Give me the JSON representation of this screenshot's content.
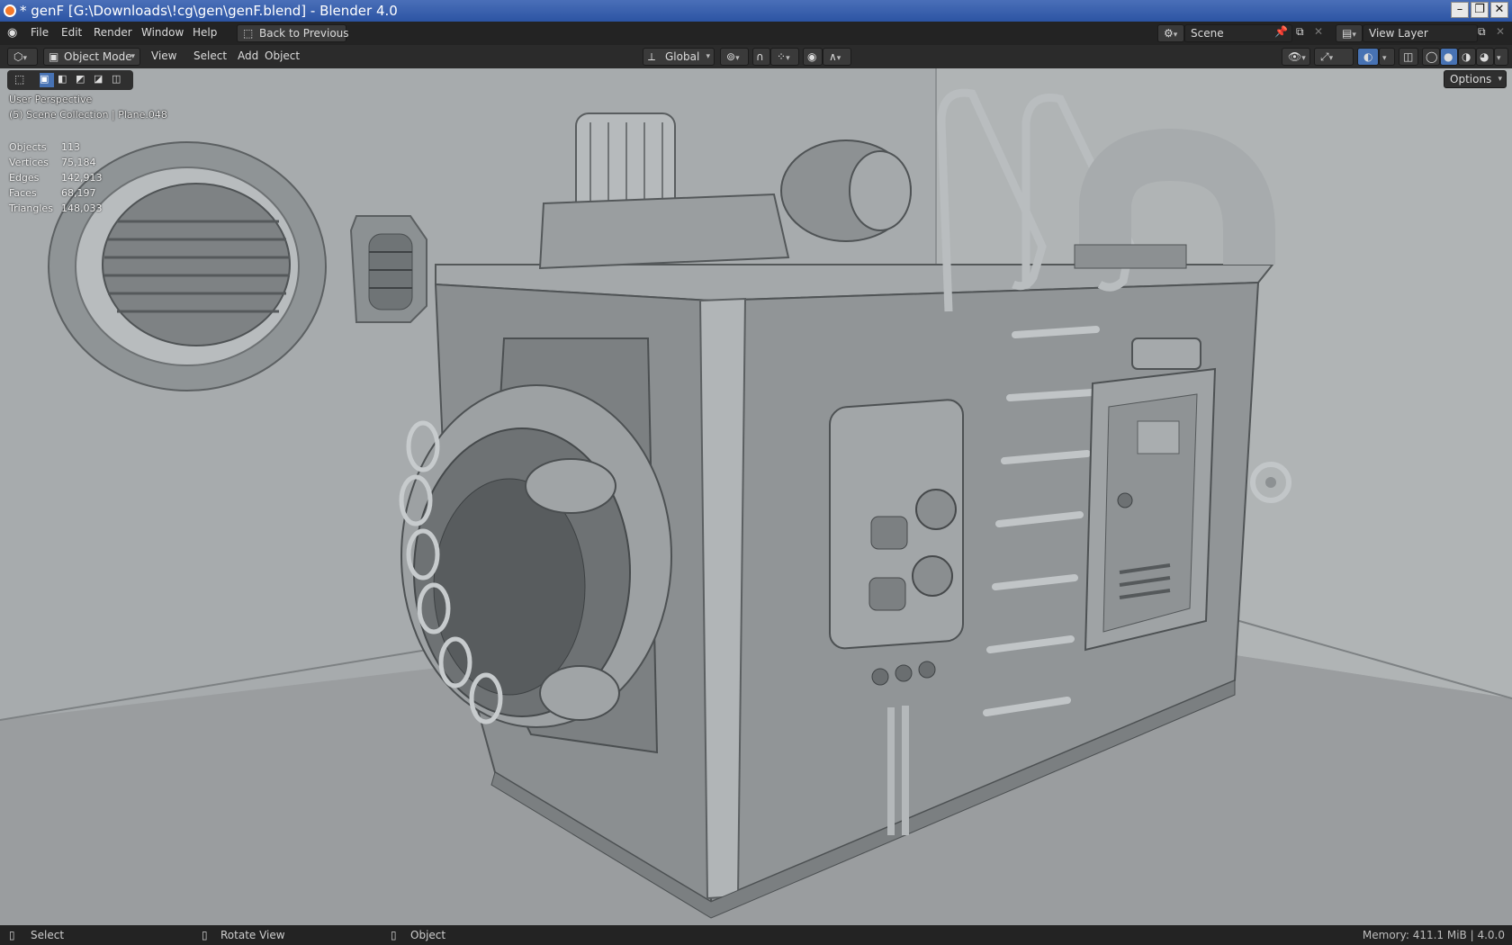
{
  "window": {
    "title": "* genF [G:\\Downloads\\!cg\\gen\\genF.blend] - Blender 4.0"
  },
  "menu": {
    "items": [
      "File",
      "Edit",
      "Render",
      "Window",
      "Help"
    ],
    "back_button": "Back to Previous",
    "scene": "Scene",
    "view_layer": "View Layer"
  },
  "header": {
    "mode": "Object Mode",
    "menus": [
      "View",
      "Select",
      "Add",
      "Object"
    ],
    "transform_orientation": "Global",
    "options": "Options"
  },
  "viewport": {
    "perspective": "User Perspective",
    "collection": "(5) Scene Collection | Plane.048",
    "stats": [
      {
        "label": "Objects",
        "value": "113"
      },
      {
        "label": "Vertices",
        "value": "75,184"
      },
      {
        "label": "Edges",
        "value": "142,913"
      },
      {
        "label": "Faces",
        "value": "68,197"
      },
      {
        "label": "Triangles",
        "value": "148,033"
      }
    ]
  },
  "status": {
    "select": "Select",
    "rotate": "Rotate View",
    "object": "Object",
    "memory": "Memory: 411.1 MiB | 4.0.0"
  },
  "colors": {
    "accent": "#4772b3",
    "brand": "#f5792a",
    "viewport_bg": "#a2a6a8"
  }
}
